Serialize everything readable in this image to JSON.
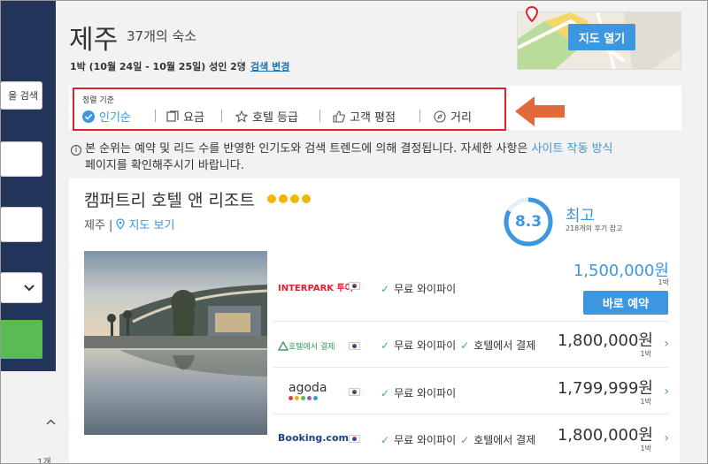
{
  "sidebar": {
    "search_button": "을 검색",
    "bottom_count": "1개"
  },
  "header": {
    "city": "제주",
    "count": "37개의 숙소",
    "dates": "1박 (10월 24일 - 10월 25일) 성인 2명",
    "change_link": "검색 변경",
    "map_button": "지도 열기"
  },
  "sort": {
    "label": "정렬 기준",
    "options": [
      {
        "label": "인기순",
        "icon": "check-circle-icon"
      },
      {
        "label": "요금",
        "icon": "price-tag-icon"
      },
      {
        "label": "호텔 등급",
        "icon": "star-outline-icon"
      },
      {
        "label": "고객 평점",
        "icon": "thumbs-up-icon"
      },
      {
        "label": "거리",
        "icon": "compass-icon"
      }
    ]
  },
  "info": {
    "text": "본 순위는 예약 및 리드 수를 반영한 인기도와 검색 트렌드에 의해 결정됩니다. 자세한 사항은 ",
    "link": "사이트 작동 방식",
    "text2": "페이지를 확인해주시기 바랍니다."
  },
  "hotel": {
    "name": "캠퍼트리 호텔 앤 리조트",
    "location": "제주 |",
    "map_link": "지도 보기",
    "rating": "8.3",
    "rating_score": 8.3,
    "rating_word": "최고",
    "reviews": "218개의 후기 참고",
    "stars": 4
  },
  "deals": [
    {
      "provider": "INTERPARK 투어",
      "features": [
        "무료 와이파이"
      ],
      "price": "1,500,000원",
      "per": "1박",
      "button": "바로 예약"
    },
    {
      "provider": "호텔에서 결제",
      "features": [
        "무료 와이파이",
        "호텔에서 결제"
      ],
      "price": "1,800,000원",
      "per": "1박"
    },
    {
      "provider": "agoda",
      "features": [
        "무료 와이파이"
      ],
      "price": "1,799,999원",
      "per": "1박"
    },
    {
      "provider": "Booking.com",
      "features": [
        "무료 와이파이",
        "호텔에서 결제"
      ],
      "price": "1,800,000원",
      "per": "1박"
    }
  ],
  "colors": {
    "accent": "#3c96e0",
    "sidebar": "#23345a",
    "highlight": "#d9232d",
    "arrow": "#e06a3c",
    "star": "#f2b705"
  }
}
